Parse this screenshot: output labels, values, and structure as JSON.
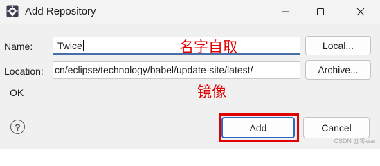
{
  "window": {
    "title": "Add Repository"
  },
  "form": {
    "name_label": "Name:",
    "name_value": "Twice",
    "location_label": "Location:",
    "location_value": "cn/eclipse/technology/babel/update-site/latest/",
    "status_text": "OK"
  },
  "buttons": {
    "local": "Local...",
    "archive": "Archive...",
    "add": "Add",
    "cancel": "Cancel"
  },
  "annotations": {
    "name_note": "名字自取",
    "location_note": "镜像",
    "highlight_color": "#e00000"
  },
  "watermark": "CSDN @零war",
  "icons": [
    "eclipse-app-icon",
    "minimize-icon",
    "maximize-icon",
    "close-icon",
    "help-icon"
  ]
}
